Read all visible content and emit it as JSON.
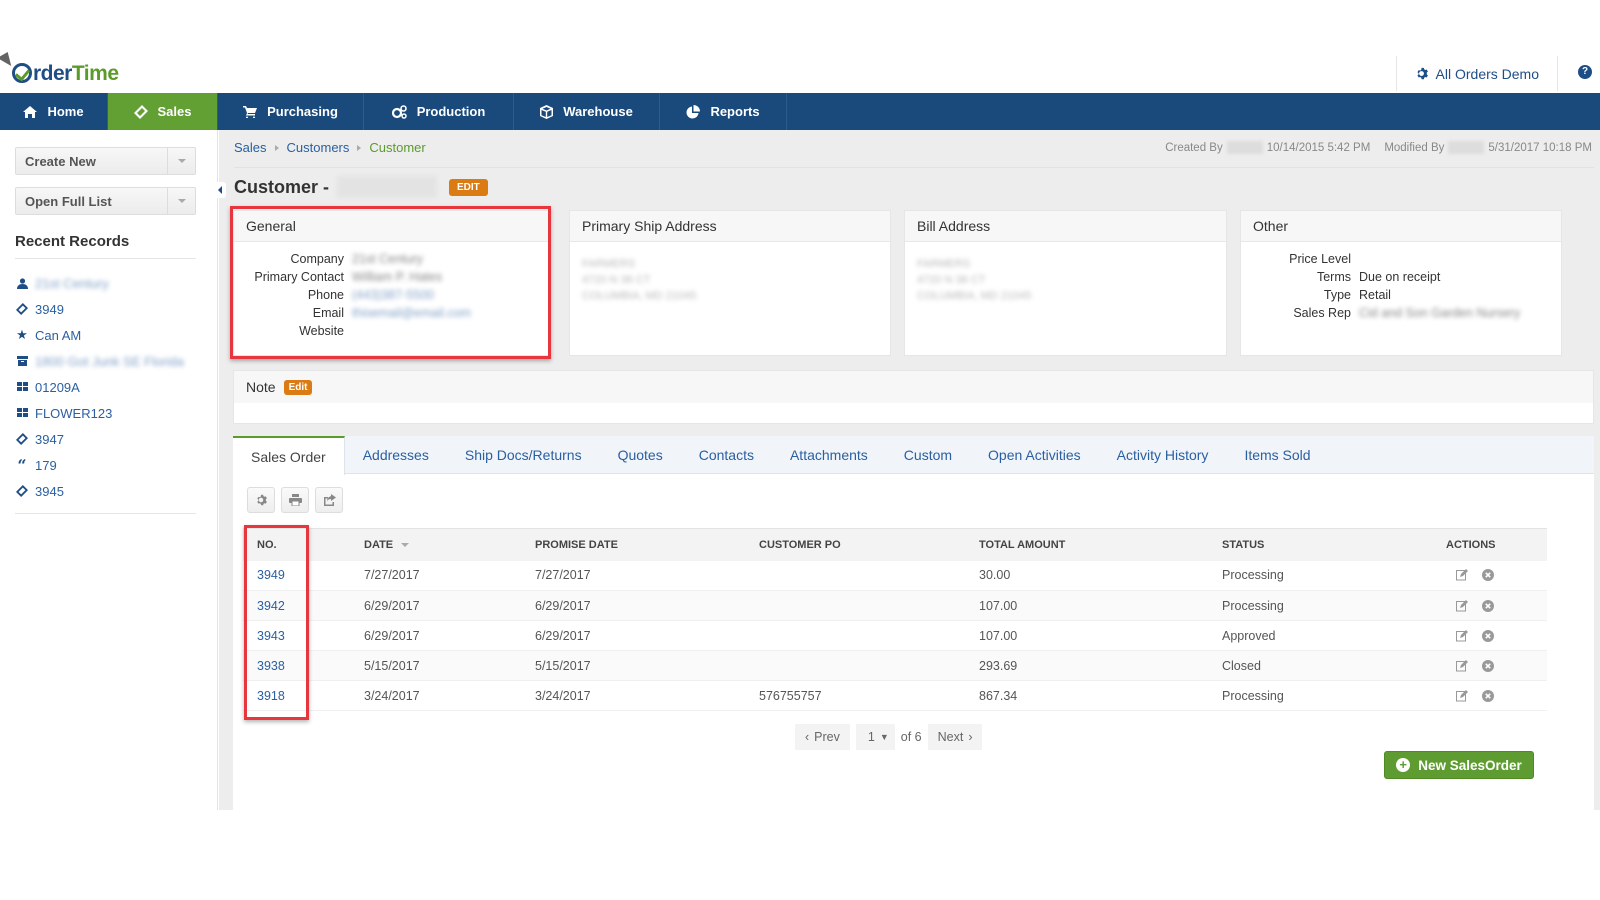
{
  "app": {
    "logo_part1": "rder",
    "logo_part2": "Time",
    "account_name": "All Orders Demo",
    "help_label": "?"
  },
  "nav": [
    {
      "label": "Home",
      "icon": "home-icon"
    },
    {
      "label": "Sales",
      "icon": "ticket-icon",
      "active": true
    },
    {
      "label": "Purchasing",
      "icon": "cart-icon"
    },
    {
      "label": "Production",
      "icon": "gears-icon"
    },
    {
      "label": "Warehouse",
      "icon": "box-icon"
    },
    {
      "label": "Reports",
      "icon": "pie-chart-icon"
    }
  ],
  "sidebar": {
    "create_new": "Create New",
    "open_full_list": "Open Full List",
    "recent_title": "Recent Records",
    "recent": [
      {
        "icon": "user-icon",
        "label": "21st Century",
        "blurred": true
      },
      {
        "icon": "ticket-icon",
        "label": "3949"
      },
      {
        "icon": "star-icon",
        "label": "Can AM"
      },
      {
        "icon": "archive-icon",
        "label": "1800 Got Junk SE Florida",
        "blurred": true
      },
      {
        "icon": "grid-icon",
        "label": "01209A"
      },
      {
        "icon": "grid-icon",
        "label": "FLOWER123"
      },
      {
        "icon": "ticket-icon",
        "label": "3947"
      },
      {
        "icon": "quote-icon",
        "label": "179"
      },
      {
        "icon": "ticket-icon",
        "label": "3945"
      }
    ]
  },
  "breadcrumb": [
    "Sales",
    "Customers",
    "Customer"
  ],
  "meta": {
    "created_label": "Created By",
    "created_at": "10/14/2015 5:42 PM",
    "modified_label": "Modified By",
    "modified_at": "5/31/2017 10:18 PM"
  },
  "page": {
    "title_prefix": "Customer -",
    "edit_label": "EDIT"
  },
  "general": {
    "title": "General",
    "fields": [
      {
        "label": "Company",
        "value": "21st Century",
        "blurred": true
      },
      {
        "label": "Primary Contact",
        "value": "William P. Hates",
        "blurred": true
      },
      {
        "label": "Phone",
        "value": "(443)387-5500",
        "blurred": true,
        "link": true
      },
      {
        "label": "Email",
        "value": "thisemail@email.com",
        "blurred": true,
        "link": true
      },
      {
        "label": "Website",
        "value": ""
      }
    ]
  },
  "ship_address": {
    "title": "Primary Ship Address",
    "lines": [
      "FARMERS",
      "4720 N 38 CT",
      "COLUMBIA, MD 21045"
    ]
  },
  "bill_address": {
    "title": "Bill Address",
    "lines": [
      "FARMERS",
      "4720 N 38 CT",
      "COLUMBIA, MD 21045"
    ]
  },
  "other": {
    "title": "Other",
    "fields": [
      {
        "label": "Price Level",
        "value": ""
      },
      {
        "label": "Terms",
        "value": "Due on receipt"
      },
      {
        "label": "Type",
        "value": "Retail"
      },
      {
        "label": "Sales Rep",
        "value": "Cid and Son Garden Nursery",
        "blurred": true
      }
    ]
  },
  "note": {
    "title": "Note",
    "edit_label": "Edit"
  },
  "tabs": [
    "Sales Order",
    "Addresses",
    "Ship Docs/Returns",
    "Quotes",
    "Contacts",
    "Attachments",
    "Custom",
    "Open Activities",
    "Activity History",
    "Items Sold"
  ],
  "table": {
    "columns": [
      "NO.",
      "DATE",
      "PROMISE DATE",
      "CUSTOMER PO",
      "TOTAL AMOUNT",
      "STATUS",
      "ACTIONS"
    ],
    "rows": [
      {
        "no": "3949",
        "date": "7/27/2017",
        "promise": "7/27/2017",
        "po": "",
        "total": "30.00",
        "status": "Processing"
      },
      {
        "no": "3942",
        "date": "6/29/2017",
        "promise": "6/29/2017",
        "po": "",
        "total": "107.00",
        "status": "Processing"
      },
      {
        "no": "3943",
        "date": "6/29/2017",
        "promise": "6/29/2017",
        "po": "",
        "total": "107.00",
        "status": "Approved"
      },
      {
        "no": "3938",
        "date": "5/15/2017",
        "promise": "5/15/2017",
        "po": "",
        "total": "293.69",
        "status": "Closed"
      },
      {
        "no": "3918",
        "date": "3/24/2017",
        "promise": "3/24/2017",
        "po": "576755757",
        "total": "867.34",
        "status": "Processing"
      }
    ]
  },
  "pager": {
    "prev": "Prev",
    "page": "1",
    "of": "of 6",
    "next": "Next"
  },
  "new_button": "New SalesOrder",
  "colors": {
    "nav_bg": "#1a4a7c",
    "nav_active": "#62a033",
    "link": "#2a5fa0",
    "edit_badge": "#db7b14",
    "highlight": "#e8363f"
  }
}
